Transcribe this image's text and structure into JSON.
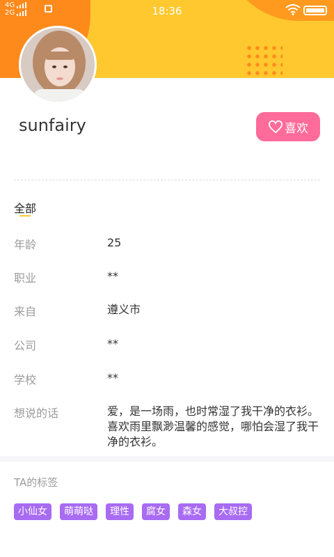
{
  "status_bar": {
    "network_top": "4G",
    "network_bottom": "2G",
    "time": "18:36",
    "icons": [
      "signal-icon",
      "sim-icon",
      "wifi-icon",
      "battery-icon"
    ]
  },
  "profile": {
    "username": "sunfairy",
    "like_label": "喜欢",
    "avatar_icon": "avatar-photo"
  },
  "section": {
    "title": "全部"
  },
  "info_rows": [
    {
      "label": "年龄",
      "value": "25"
    },
    {
      "label": "职业",
      "value": "**"
    },
    {
      "label": "来自",
      "value": "遵义市"
    },
    {
      "label": "公司",
      "value": "**"
    },
    {
      "label": "学校",
      "value": "**"
    },
    {
      "label": "想说的话",
      "value": "爱，是一场雨，也时常湿了我干净的衣衫。喜欢雨里飘渺温馨的感觉，哪怕会湿了我干净的衣衫。"
    }
  ],
  "tags_section": {
    "title": "TA的标签",
    "tags": [
      "小仙女",
      "萌萌哒",
      "理性",
      "腐女",
      "森女",
      "大叔控"
    ]
  },
  "colors": {
    "header_yellow": "#ffc82e",
    "header_orange": "#ff8a1c",
    "like_pink": "#ff6b9a",
    "tag_purple": "#a86bf2"
  }
}
